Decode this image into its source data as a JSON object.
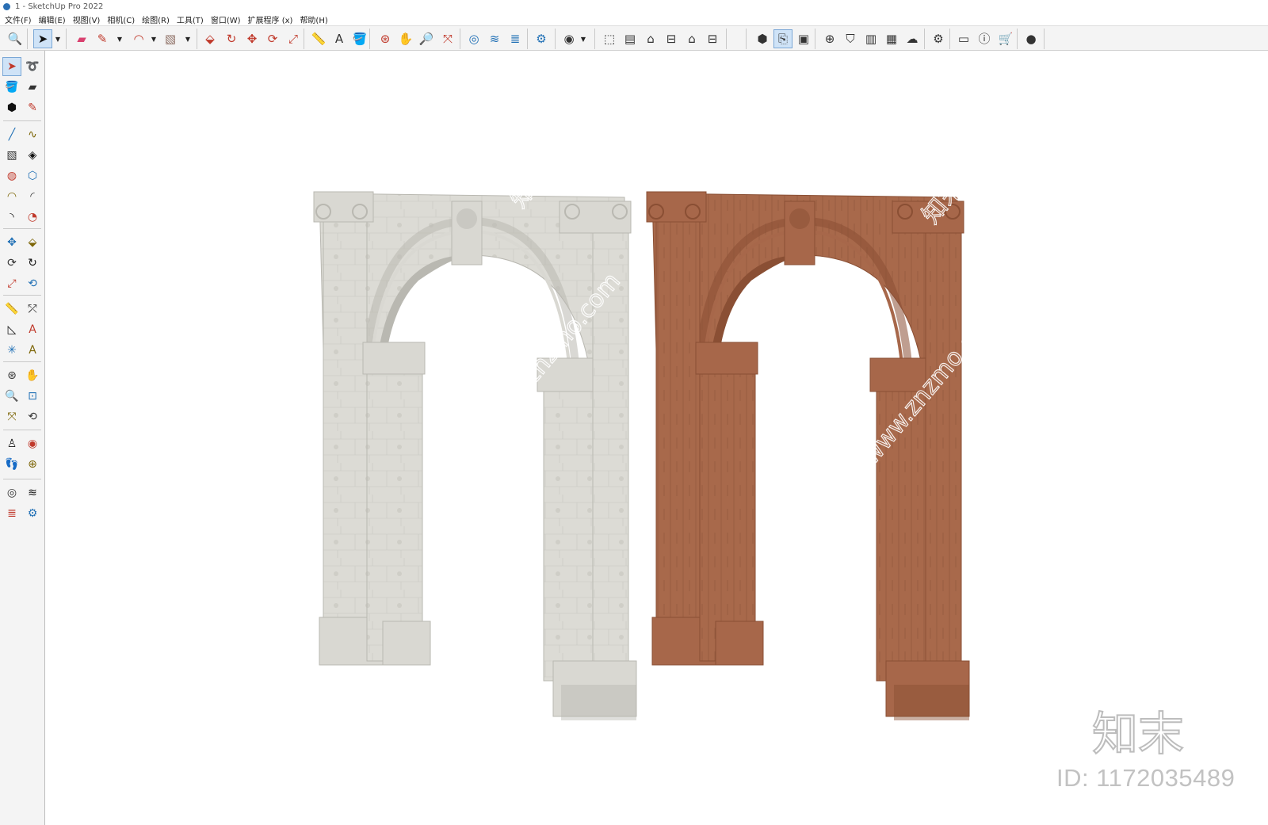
{
  "window": {
    "title": "1 - SketchUp Pro 2022"
  },
  "menu": [
    "文件(F)",
    "编辑(E)",
    "视图(V)",
    "相机(C)",
    "绘图(R)",
    "工具(T)",
    "窗口(W)",
    "扩展程序 (x)",
    "帮助(H)"
  ],
  "toolbar": {
    "icons": [
      {
        "name": "zoom-icon",
        "glyph": "🔍"
      },
      {
        "name": "select-icon",
        "glyph": "➤"
      },
      {
        "name": "eraser-icon",
        "glyph": "▰"
      },
      {
        "name": "line-icon",
        "glyph": "✎"
      },
      {
        "name": "arc-icon",
        "glyph": "◠"
      },
      {
        "name": "rectangle-icon",
        "glyph": "▧"
      },
      {
        "name": "push-pull-icon",
        "glyph": "⬙"
      },
      {
        "name": "follow-me-icon",
        "glyph": "↻"
      },
      {
        "name": "move-icon",
        "glyph": "✥"
      },
      {
        "name": "rotate-icon",
        "glyph": "⟳"
      },
      {
        "name": "scale-icon",
        "glyph": "⤢"
      },
      {
        "name": "tape-measure-icon",
        "glyph": "📏"
      },
      {
        "name": "text-icon",
        "glyph": "A"
      },
      {
        "name": "paint-bucket-icon",
        "glyph": "🪣"
      },
      {
        "name": "orbit-icon",
        "glyph": "⊛"
      },
      {
        "name": "pan-icon",
        "glyph": "✋"
      },
      {
        "name": "zoom-window-icon",
        "glyph": "🔎"
      },
      {
        "name": "zoom-extents-icon",
        "glyph": "⤧"
      },
      {
        "name": "3d-warehouse-icon",
        "glyph": "◎"
      },
      {
        "name": "extension-warehouse-icon",
        "glyph": "≋"
      },
      {
        "name": "layout-icon",
        "glyph": "≣"
      },
      {
        "name": "extension-manager-icon",
        "glyph": "⚙"
      },
      {
        "name": "account-icon",
        "glyph": "◉"
      },
      {
        "name": "iso-view-icon",
        "glyph": "⬚"
      },
      {
        "name": "top-view-icon",
        "glyph": "▤"
      },
      {
        "name": "front-view-icon",
        "glyph": "⌂"
      },
      {
        "name": "right-view-icon",
        "glyph": "⊟"
      },
      {
        "name": "back-view-icon",
        "glyph": "⌂"
      },
      {
        "name": "left-view-icon",
        "glyph": "⊟"
      },
      {
        "name": "solid-tools-icon",
        "glyph": "⬢"
      },
      {
        "name": "section-plane-icon",
        "glyph": "⎘"
      },
      {
        "name": "camera-scene-icon",
        "glyph": "▣"
      },
      {
        "name": "add-location-icon",
        "glyph": "⊕"
      },
      {
        "name": "shield-icon",
        "glyph": "⛉"
      },
      {
        "name": "sandbox-icon",
        "glyph": "▥"
      },
      {
        "name": "texture-icon",
        "glyph": "▦"
      },
      {
        "name": "cloud-icon",
        "glyph": "☁"
      },
      {
        "name": "settings-icon",
        "glyph": "⚙"
      },
      {
        "name": "styles-icon",
        "glyph": "▭"
      },
      {
        "name": "info-icon",
        "glyph": "ⓘ"
      },
      {
        "name": "cart-icon",
        "glyph": "🛒"
      },
      {
        "name": "profile-icon",
        "glyph": "●"
      }
    ]
  },
  "left_tools": [
    {
      "name": "select-tool-icon",
      "glyph": "➤",
      "active": true
    },
    {
      "name": "lasso-tool-icon",
      "glyph": "➰"
    },
    {
      "name": "paint-tool-icon",
      "glyph": "🪣"
    },
    {
      "name": "eraser-tool-icon",
      "glyph": "▰"
    },
    {
      "name": "make-component-icon",
      "glyph": "⬢"
    },
    {
      "name": "tag-tool-icon",
      "glyph": "✎"
    },
    {
      "name": "line-tool-icon",
      "glyph": "╱"
    },
    {
      "name": "freehand-tool-icon",
      "glyph": "∿"
    },
    {
      "name": "rectangle-tool-icon",
      "glyph": "▧"
    },
    {
      "name": "rotated-rect-icon",
      "glyph": "◈"
    },
    {
      "name": "circle-tool-icon",
      "glyph": "◍"
    },
    {
      "name": "polygon-tool-icon",
      "glyph": "⬡"
    },
    {
      "name": "arc-tool-icon",
      "glyph": "◠"
    },
    {
      "name": "two-point-arc-icon",
      "glyph": "◜"
    },
    {
      "name": "three-point-arc-icon",
      "glyph": "◝"
    },
    {
      "name": "pie-tool-icon",
      "glyph": "◔"
    },
    {
      "name": "move-tool-icon",
      "glyph": "✥"
    },
    {
      "name": "push-pull-tool-icon",
      "glyph": "⬙"
    },
    {
      "name": "rotate-tool-icon",
      "glyph": "⟳"
    },
    {
      "name": "follow-me-tool-icon",
      "glyph": "↻"
    },
    {
      "name": "scale-tool-icon",
      "glyph": "⤢"
    },
    {
      "name": "offset-tool-icon",
      "glyph": "⟲"
    },
    {
      "name": "tape-tool-icon",
      "glyph": "📏"
    },
    {
      "name": "dimension-tool-icon",
      "glyph": "⤱"
    },
    {
      "name": "protractor-tool-icon",
      "glyph": "◺"
    },
    {
      "name": "text-tool-icon",
      "glyph": "A"
    },
    {
      "name": "axes-tool-icon",
      "glyph": "✳"
    },
    {
      "name": "3d-text-tool-icon",
      "glyph": "A"
    },
    {
      "name": "orbit-tool-icon",
      "glyph": "⊛"
    },
    {
      "name": "pan-tool-icon",
      "glyph": "✋"
    },
    {
      "name": "zoom-tool-icon",
      "glyph": "🔍"
    },
    {
      "name": "zoom-window-tool-icon",
      "glyph": "⊡"
    },
    {
      "name": "zoom-extents-tool-icon",
      "glyph": "⤧"
    },
    {
      "name": "previous-view-icon",
      "glyph": "⟲"
    },
    {
      "name": "position-camera-icon",
      "glyph": "♙"
    },
    {
      "name": "look-around-icon",
      "glyph": "◉"
    },
    {
      "name": "walk-tool-icon",
      "glyph": "👣"
    },
    {
      "name": "section-tool-icon",
      "glyph": "⊕"
    },
    {
      "name": "warehouse-tool-icon",
      "glyph": "◎"
    },
    {
      "name": "extension-tool-icon",
      "glyph": "≋"
    },
    {
      "name": "layout-tool-icon",
      "glyph": "≣"
    },
    {
      "name": "extension-manager-tool-icon",
      "glyph": "⚙"
    }
  ],
  "models": [
    {
      "name": "stone-arch",
      "material": "concrete",
      "color": "#d9d8d2",
      "shade": "#b9b8b1"
    },
    {
      "name": "terracotta-arch",
      "material": "terracotta",
      "color": "#a7674a",
      "shade": "#8a4f34"
    }
  ],
  "watermark": {
    "logo_text": "知末",
    "id_text": "ID: 1172035489",
    "overlay_text": "知末网 www.znzmo.com",
    "color": "#c2c2c2"
  }
}
